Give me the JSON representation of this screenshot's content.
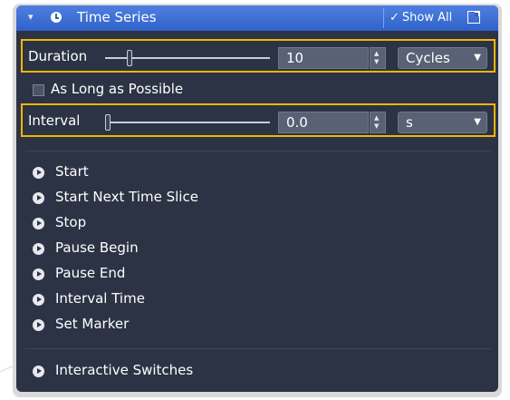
{
  "header": {
    "collapse_glyph": "▾",
    "clock_icon": "clock-icon",
    "title": "Time Series",
    "check_glyph": "✓",
    "show_all_label": "Show All",
    "popout_icon": "popout-icon"
  },
  "duration": {
    "label": "Duration",
    "slider_level": 0.15,
    "value": "10",
    "unit_selected": "Cycles"
  },
  "long_as_possible": {
    "label": "As Long as Possible",
    "checked": false
  },
  "interval": {
    "label": "Interval",
    "slider_level": 0.0,
    "value": "0.0",
    "unit_selected": "s"
  },
  "actions": [
    {
      "label": "Start"
    },
    {
      "label": "Start Next Time Slice"
    },
    {
      "label": "Stop"
    },
    {
      "label": "Pause Begin"
    },
    {
      "label": "Pause End"
    },
    {
      "label": "Interval Time"
    },
    {
      "label": "Set Marker"
    }
  ],
  "interactive_switches": {
    "label": "Interactive Switches"
  },
  "colors": {
    "panel": "#2c3344",
    "header": "#3a6ed6",
    "highlight": "#f2b705"
  },
  "spinner_glyphs": {
    "up": "▲",
    "down": "▼"
  },
  "dropdown_glyph": "▼"
}
